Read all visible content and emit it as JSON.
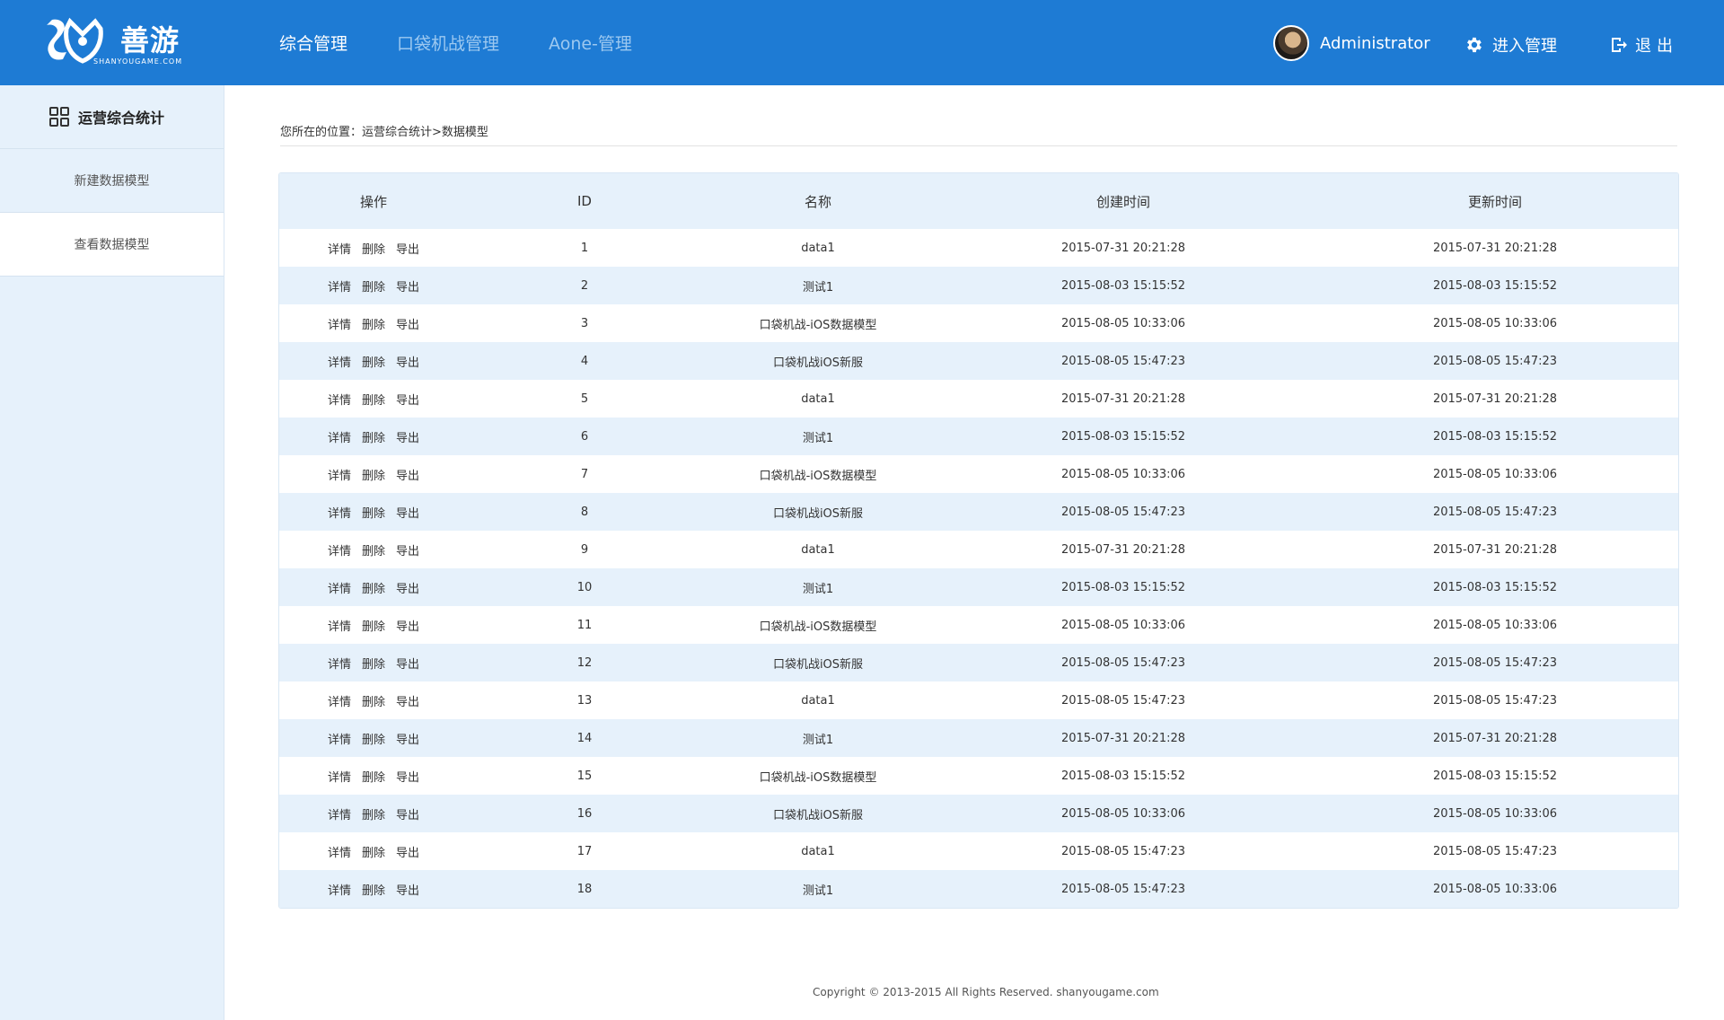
{
  "header": {
    "brand": "善游",
    "brand_sub": "SHANYOUGAME.COM",
    "nav": [
      {
        "label": "综合管理",
        "active": true
      },
      {
        "label": "口袋机战管理",
        "active": false
      },
      {
        "label": "Aone-管理",
        "active": false
      }
    ],
    "username": "Administrator",
    "manage_label": "进入管理",
    "logout_label": "退出"
  },
  "sidebar": {
    "title": "运营综合统计",
    "items": [
      {
        "label": "新建数据模型"
      },
      {
        "label": "查看数据模型"
      }
    ]
  },
  "breadcrumb": "您所在的位置：运营综合统计>数据模型",
  "table": {
    "columns": [
      "操作",
      "ID",
      "名称",
      "创建时间",
      "更新时间"
    ],
    "actions": [
      "详情",
      "删除",
      "导出"
    ],
    "rows": [
      {
        "id": "1",
        "name": "data1",
        "created": "2015-07-31 20:21:28",
        "updated": "2015-07-31 20:21:28"
      },
      {
        "id": "2",
        "name": "测试1",
        "created": "2015-08-03 15:15:52",
        "updated": "2015-08-03 15:15:52"
      },
      {
        "id": "3",
        "name": "口袋机战-iOS数据模型",
        "created": "2015-08-05 10:33:06",
        "updated": "2015-08-05 10:33:06"
      },
      {
        "id": "4",
        "name": "口袋机战iOS新服",
        "created": "2015-08-05 15:47:23",
        "updated": "2015-08-05 15:47:23"
      },
      {
        "id": "5",
        "name": "data1",
        "created": "2015-07-31 20:21:28",
        "updated": "2015-07-31 20:21:28"
      },
      {
        "id": "6",
        "name": "测试1",
        "created": "2015-08-03 15:15:52",
        "updated": "2015-08-03 15:15:52"
      },
      {
        "id": "7",
        "name": "口袋机战-iOS数据模型",
        "created": "2015-08-05 10:33:06",
        "updated": "2015-08-05 10:33:06"
      },
      {
        "id": "8",
        "name": "口袋机战iOS新服",
        "created": "2015-08-05 15:47:23",
        "updated": "2015-08-05 15:47:23"
      },
      {
        "id": "9",
        "name": "data1",
        "created": "2015-07-31 20:21:28",
        "updated": "2015-07-31 20:21:28"
      },
      {
        "id": "10",
        "name": "测试1",
        "created": "2015-08-03 15:15:52",
        "updated": "2015-08-03 15:15:52"
      },
      {
        "id": "11",
        "name": "口袋机战-iOS数据模型",
        "created": "2015-08-05 10:33:06",
        "updated": "2015-08-05 10:33:06"
      },
      {
        "id": "12",
        "name": "口袋机战iOS新服",
        "created": "2015-08-05 15:47:23",
        "updated": "2015-08-05 15:47:23"
      },
      {
        "id": "13",
        "name": "data1",
        "created": "2015-08-05 15:47:23",
        "updated": "2015-08-05 15:47:23"
      },
      {
        "id": "14",
        "name": "测试1",
        "created": "2015-07-31 20:21:28",
        "updated": "2015-07-31 20:21:28"
      },
      {
        "id": "15",
        "name": "口袋机战-iOS数据模型",
        "created": "2015-08-03 15:15:52",
        "updated": "2015-08-03 15:15:52"
      },
      {
        "id": "16",
        "name": "口袋机战iOS新服",
        "created": "2015-08-05 10:33:06",
        "updated": "2015-08-05 10:33:06"
      },
      {
        "id": "17",
        "name": "data1",
        "created": "2015-08-05 15:47:23",
        "updated": "2015-08-05 15:47:23"
      },
      {
        "id": "18",
        "name": "测试1",
        "created": "2015-08-05 15:47:23",
        "updated": "2015-08-05 10:33:06"
      }
    ]
  },
  "footer": {
    "copyright": "Copyright © 2013-2015 All Rights Reserved. shanyougame.com"
  },
  "colors": {
    "header_bg": "#1e7bd4",
    "sidebar_bg": "#e6f1fb",
    "nav_inactive": "#9cc8f0"
  },
  "icons": {
    "logo": "logo-mark",
    "manage": "gear-icon",
    "logout": "logout-icon",
    "sidebar_title": "grid-icon"
  }
}
